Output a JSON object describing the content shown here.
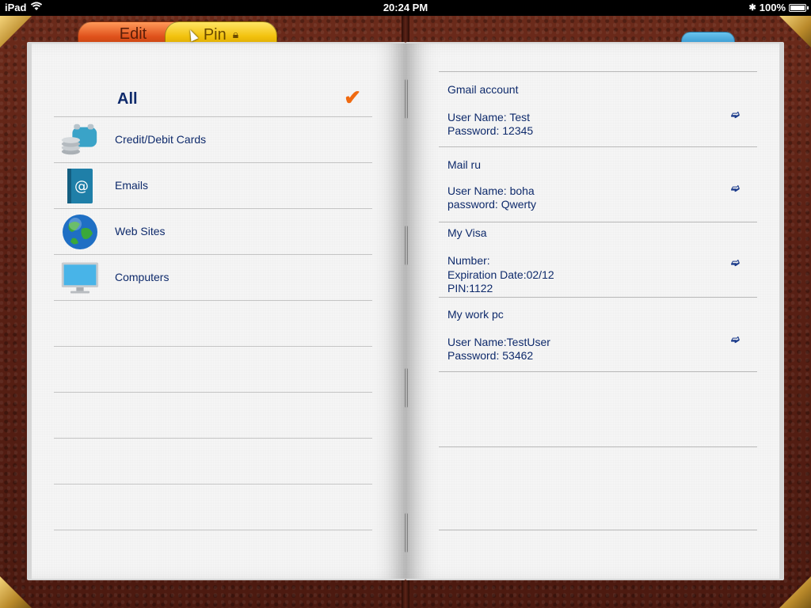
{
  "status_bar": {
    "device": "iPad",
    "time": "20:24 PM",
    "battery": "100%",
    "battery_level": 1.0
  },
  "tabs": {
    "edit": "Edit",
    "pin": "Pin"
  },
  "categories": {
    "all_label": "All",
    "items": [
      {
        "label": "Credit/Debit Cards",
        "icon": "wallet-coins-icon"
      },
      {
        "label": "Emails",
        "icon": "email-book-icon"
      },
      {
        "label": "Web Sites",
        "icon": "globe-icon"
      },
      {
        "label": "Computers",
        "icon": "monitor-icon"
      }
    ]
  },
  "entries": [
    {
      "title": "Gmail account",
      "lines": [
        "User Name: Test",
        "Password: 12345"
      ]
    },
    {
      "title": "Mail ru",
      "lines": [
        "User Name: boha",
        "password: Qwerty"
      ]
    },
    {
      "title": "My Visa",
      "lines": [
        "Number:",
        "Expiration Date:02/12",
        "PIN:1122"
      ]
    },
    {
      "title": "My work pc",
      "lines": [
        "User Name:TestUser",
        "Password: 53462"
      ]
    }
  ],
  "colors": {
    "text": "#0e2a6b",
    "check": "#f06a10",
    "edit_tab": "#e0521c",
    "pin_tab": "#f2c20e",
    "leather": "#5a2014"
  }
}
